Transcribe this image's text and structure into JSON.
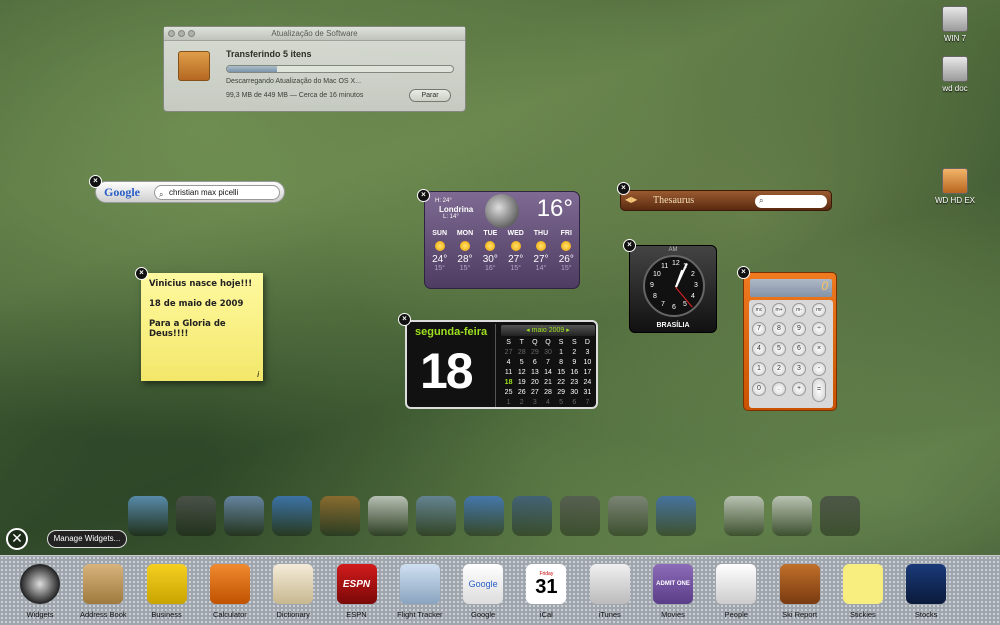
{
  "desktop_icons": [
    {
      "label": "WIN 7",
      "icon": "hard-drive-icon"
    },
    {
      "label": "wd doc",
      "icon": "hard-drive-icon"
    },
    {
      "label": "WD HD EX",
      "icon": "external-drive-icon"
    }
  ],
  "software_update": {
    "title": "Atualização de Software",
    "heading": "Transferindo 5 itens",
    "status": "Descarregando Atualização do Mac OS X...",
    "detail": "99,3 MB de 449 MB — Cerca de 16 minutos",
    "stop_label": "Parar",
    "progress_fraction": 0.22
  },
  "google": {
    "logo": "Google",
    "query": "christian max picelli"
  },
  "sticky": {
    "lines": [
      "Vinicius nasce hoje!!!",
      "18 de maio de 2009",
      "Para a Gloria de Deus!!!!"
    ],
    "info": "i"
  },
  "weather": {
    "hi": "H: 24°",
    "lo": "L: 14°",
    "city": "Londrina",
    "temp": "16°",
    "days": [
      {
        "name": "SUN",
        "hi": "24°",
        "lo": "15°"
      },
      {
        "name": "MON",
        "hi": "28°",
        "lo": "15°"
      },
      {
        "name": "TUE",
        "hi": "30°",
        "lo": "16°"
      },
      {
        "name": "WED",
        "hi": "27°",
        "lo": "15°"
      },
      {
        "name": "THU",
        "hi": "27°",
        "lo": "14°"
      },
      {
        "name": "FRI",
        "hi": "26°",
        "lo": "15°"
      }
    ]
  },
  "thesaurus": {
    "name": "Thesaurus"
  },
  "clock": {
    "ampm": "AM",
    "city": "BRASÍLIA",
    "numbers": [
      "12",
      "1",
      "2",
      "3",
      "4",
      "5",
      "6",
      "7",
      "8",
      "9",
      "10",
      "11"
    ]
  },
  "calculator": {
    "display": "0",
    "keys": [
      "mc",
      "m+",
      "m-",
      "mr",
      "7",
      "8",
      "9",
      "÷",
      "4",
      "5",
      "6",
      "×",
      "1",
      "2",
      "3",
      "-",
      "0",
      ".",
      "+",
      "C",
      "="
    ]
  },
  "ical": {
    "weekday": "segunda-feira",
    "day": "18",
    "month": "maio 2009",
    "headers": [
      "S",
      "T",
      "Q",
      "Q",
      "S",
      "S",
      "D"
    ],
    "cells": [
      "27",
      "28",
      "29",
      "30",
      "1",
      "2",
      "3",
      "4",
      "5",
      "6",
      "7",
      "8",
      "9",
      "10",
      "11",
      "12",
      "13",
      "14",
      "15",
      "16",
      "17",
      "18",
      "19",
      "20",
      "21",
      "22",
      "23",
      "24",
      "25",
      "26",
      "27",
      "28",
      "29",
      "30",
      "31",
      "1",
      "2",
      "3",
      "4",
      "5",
      "6",
      "7"
    ]
  },
  "manage_widgets_label": "Manage Widgets...",
  "close_all_glyph": "✕",
  "dock_icons": [
    "finder-icon",
    "dashboard-icon",
    "mail-icon",
    "safari-icon",
    "address-book-icon",
    "ical-icon",
    "iphoto-icon",
    "itunes-icon",
    "spaces-icon",
    "time-machine-icon",
    "system-preferences-icon",
    "sync-icon",
    "pdf-icon",
    "pdf-icon",
    "trash-icon"
  ],
  "widget_bar": [
    {
      "label": "Widgets"
    },
    {
      "label": "Address Book"
    },
    {
      "label": "Business"
    },
    {
      "label": "Calculator"
    },
    {
      "label": "Dictionary"
    },
    {
      "label": "ESPN"
    },
    {
      "label": "Flight Tracker"
    },
    {
      "label": "Google"
    },
    {
      "label": "iCal"
    },
    {
      "label": "iTunes"
    },
    {
      "label": "Movies"
    },
    {
      "label": "People"
    },
    {
      "label": "Ski Report"
    },
    {
      "label": "Stickies"
    },
    {
      "label": "Stocks"
    }
  ],
  "widget_bar_texts": {
    "espn": "ESPN",
    "google": "Google",
    "ical_day": "Friday",
    "ical_num": "31",
    "movies": "ADMIT ONE"
  }
}
